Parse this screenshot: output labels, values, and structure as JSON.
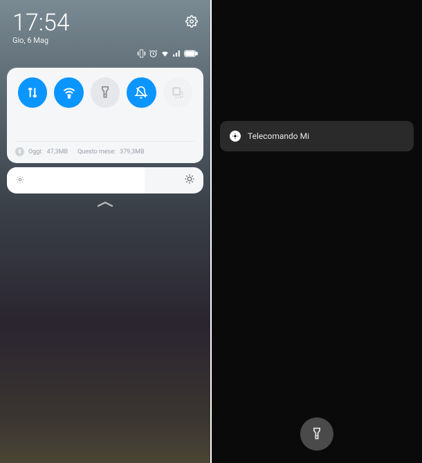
{
  "left": {
    "clock": "17:54",
    "date": "Gio, 6 Mag",
    "toggles": {
      "data": {
        "active": true
      },
      "wifi": {
        "active": true
      },
      "flashlight": {
        "active": false
      },
      "dnd": {
        "active": true
      },
      "screenshot": {
        "active": false,
        "disabled": true
      }
    },
    "usage": {
      "today_label": "Oggi:",
      "today_value": "47,3MB",
      "month_label": "Questo mese:",
      "month_value": "379,3MB"
    },
    "brightness_percent": 70
  },
  "right": {
    "notification": {
      "title": "Telecomando Mi"
    }
  },
  "colors": {
    "accent": "#0b95ff",
    "card_bg": "#f5f6f8",
    "toggle_off": "#e5e7ea"
  }
}
